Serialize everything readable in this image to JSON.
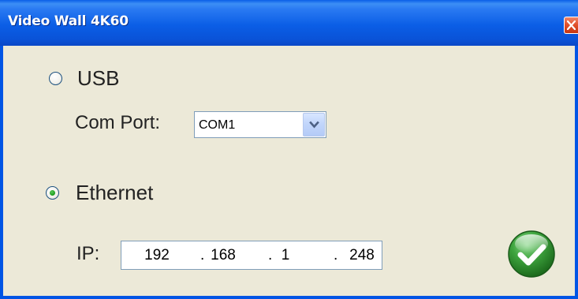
{
  "window": {
    "title": "Video Wall 4K60",
    "close_icon": "close-icon"
  },
  "connection": {
    "usb": {
      "label": "USB",
      "selected": false
    },
    "com_port": {
      "label": "Com Port:",
      "value": "COM1",
      "dropdown_icon": "chevron-down-icon"
    },
    "ethernet": {
      "label": "Ethernet",
      "selected": true
    },
    "ip": {
      "label": "IP:",
      "octets": [
        "192",
        "168",
        "1",
        "248"
      ],
      "separator": "."
    }
  },
  "actions": {
    "ok_icon": "checkmark-icon"
  },
  "colors": {
    "titlebar": "#0a5fe8",
    "window_bg": "#ece9d8",
    "close_button": "#e2512d",
    "ok_button": "#2e8a2e"
  }
}
